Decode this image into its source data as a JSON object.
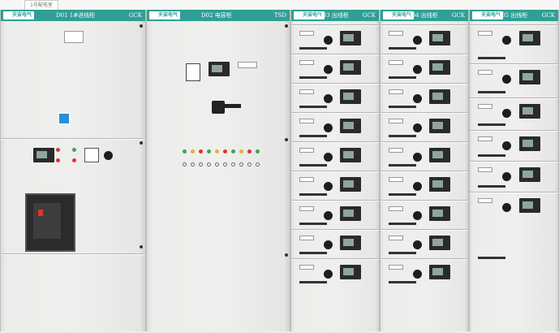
{
  "colors": {
    "header": "#2f9f95",
    "panel": "#ececeb",
    "breaker": "#2b2b2b",
    "lamp_red": "#d9382b",
    "lamp_green": "#3aa552",
    "lamp_yellow": "#e0b23a"
  },
  "brand": "天宙电气",
  "top_label": "1号配电室",
  "cabinets": [
    {
      "code": "D01 1#进线柜",
      "type": "GCK"
    },
    {
      "code": "D02 电容柜",
      "type": "TSD"
    },
    {
      "code": "D03 出线柜",
      "type": "GCK"
    },
    {
      "code": "D04 出线柜",
      "type": "GCK"
    },
    {
      "code": "D05 出线柜",
      "type": "GCK"
    }
  ],
  "icons": {
    "logo": "brand-logo-icon",
    "knob": "rotary-switch-icon",
    "meter": "digital-meter-icon",
    "lamp": "indicator-lamp-icon"
  }
}
